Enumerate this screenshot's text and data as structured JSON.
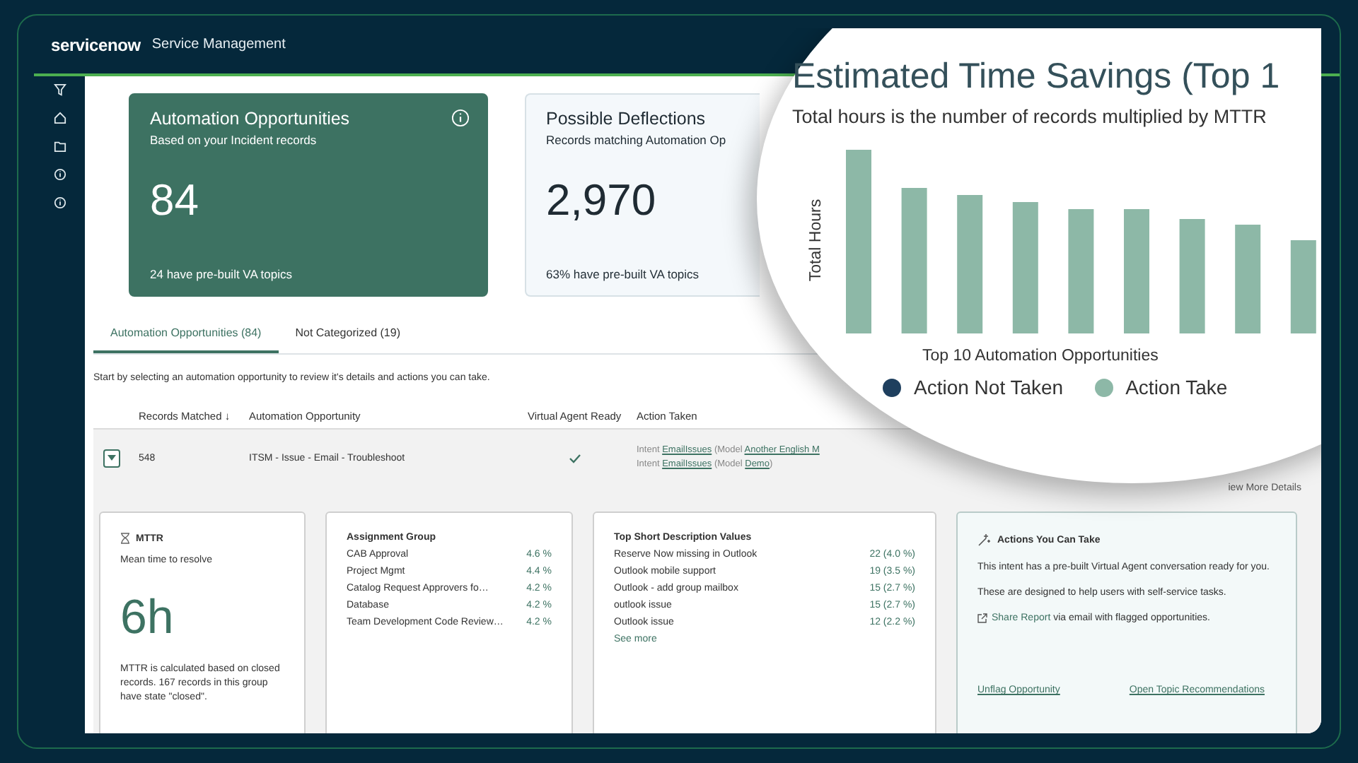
{
  "header": {
    "brand": "servicenow",
    "title": "Service Management"
  },
  "summary_cards": [
    {
      "title": "Automation Opportunities",
      "subtitle": "Based on your Incident records",
      "value": "84",
      "footnote": "24 have pre-built VA topics",
      "selected": true
    },
    {
      "title": "Possible Deflections",
      "subtitle": "Records matching Automation Op",
      "value": "2,970",
      "footnote": "63% have pre-built VA topics",
      "selected": false
    }
  ],
  "tabs": [
    {
      "label": "Automation Opportunities (84)",
      "selected": true
    },
    {
      "label": "Not Categorized (19)",
      "selected": false
    }
  ],
  "instructions": "Start by selecting an automation opportunity to review it's details and actions you can take.",
  "table": {
    "columns": [
      "Records Matched ↓",
      "Automation Opportunity",
      "Virtual Agent Ready",
      "Action Taken"
    ],
    "rows": [
      {
        "records": "548",
        "opportunity": "ITSM - Issue - Email - Troubleshoot",
        "va_ready": true,
        "expanded": true,
        "actions": [
          {
            "prefix": "Intent",
            "intent": "EmailIssues",
            "middle": "(Model",
            "model": "Another English M"
          },
          {
            "prefix": "Intent",
            "intent": "EmailIssues",
            "middle": "(Model",
            "model": "Demo",
            "suffix": ")"
          }
        ]
      }
    ]
  },
  "details": {
    "more_link": "iew More Details",
    "mttr": {
      "title": "MTTR",
      "subtitle": "Mean time to resolve",
      "value": "6h",
      "note": "MTTR is calculated based on closed records. 167 records in this group have state \"closed\"."
    },
    "assignment_group": {
      "title": "Assignment Group",
      "rows": [
        {
          "name": "CAB Approval",
          "value": "4.6 %"
        },
        {
          "name": "Project Mgmt",
          "value": "4.4 %"
        },
        {
          "name": "Catalog Request Approvers fo…",
          "value": "4.2 %"
        },
        {
          "name": "Database",
          "value": "4.2 %"
        },
        {
          "name": "Team Development Code Review…",
          "value": "4.2 %"
        }
      ]
    },
    "short_descriptions": {
      "title": "Top Short Description Values",
      "rows": [
        {
          "name": "Reserve Now missing in Outlook",
          "value": "22 (4.0 %)"
        },
        {
          "name": "Outlook mobile support",
          "value": "19 (3.5 %)"
        },
        {
          "name": "Outlook - add group mailbox",
          "value": "15 (2.7 %)"
        },
        {
          "name": "outlook issue",
          "value": "15 (2.7 %)"
        },
        {
          "name": "Outlook issue",
          "value": "12 (2.2 %)"
        }
      ],
      "more": "See more"
    },
    "actions": {
      "title": "Actions You Can Take",
      "lines": [
        "This intent has a pre-built Virtual Agent conversation ready for you.",
        "These are designed to help users with self-service tasks."
      ],
      "share_link": "Share Report",
      "share_text": "via email with flagged opportunities.",
      "links": [
        "Unflag Opportunity",
        "Open Topic Recommendations"
      ]
    }
  },
  "magnifier": {
    "title": "Estimated Time Savings (Top 1",
    "subtitle": "Total hours is the number of records multiplied by MTTR",
    "ylabel": "Total Hours",
    "xlabel": "Top 10 Automation Opportunities",
    "legend": [
      {
        "label": "Action Not Taken",
        "color": "#1e3f5e"
      },
      {
        "label": "Action Take",
        "color": "#8db8a7"
      }
    ]
  }
}
